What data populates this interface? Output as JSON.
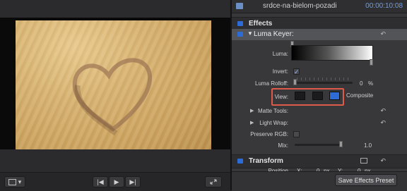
{
  "inspector": {
    "clip_name": "srdce-na-bielom-pozadi",
    "timecode": "00:00:10:08",
    "effects_title": "Effects",
    "luma_keyer_title": "Luma Keyer:",
    "luma_label": "Luma:",
    "invert_label": "Invert:",
    "invert_checked": true,
    "luma_rolloff_label": "Luma Rolloff:",
    "luma_rolloff_value": "0",
    "luma_rolloff_unit": "%",
    "view_label": "View:",
    "view_mode": "Composite",
    "matte_tools_label": "Matte Tools:",
    "light_wrap_label": "Light Wrap:",
    "preserve_rgb_label": "Preserve RGB:",
    "mix_label": "Mix:",
    "mix_value": "1.0",
    "transform_title": "Transform",
    "position_label": "Position",
    "position_x_label": "X:",
    "position_x_value": "0",
    "position_x_unit": "px",
    "position_y_label": "Y:",
    "position_y_value": "0",
    "position_y_unit": "px",
    "save_button": "Save Effects Preset"
  },
  "viewer": {
    "prev_glyph": "|◀",
    "play_glyph": "▶",
    "next_glyph": "▶|",
    "view_menu_glyph": "▾"
  },
  "colors": {
    "accent_blue": "#2d6bd6",
    "timecode_blue": "#6f9fe0",
    "highlight_red": "#e05a4a"
  }
}
